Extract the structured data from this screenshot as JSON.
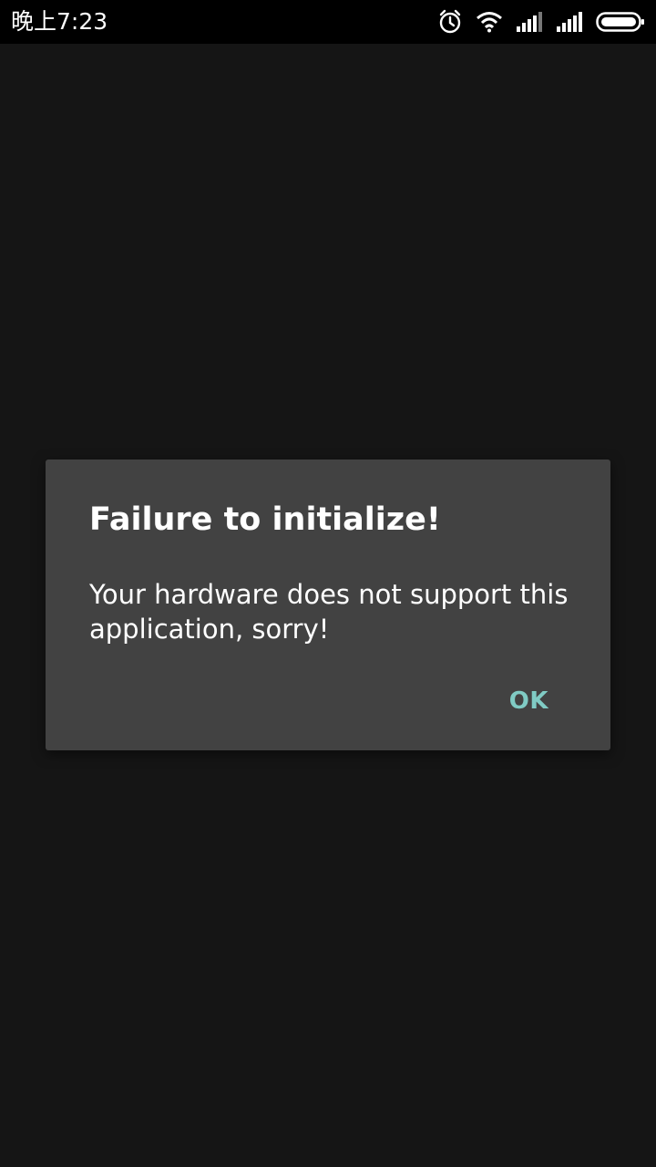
{
  "status_bar": {
    "time": "晚上7:23",
    "icons": [
      "alarm-icon",
      "wifi-icon",
      "signal-1-icon",
      "signal-2-icon",
      "battery-icon"
    ]
  },
  "dialog": {
    "title": "Failure to initialize!",
    "message": "Your hardware does not support this application, sorry!",
    "ok_label": "OK"
  },
  "colors": {
    "background": "#151515",
    "status_bar": "#000000",
    "dialog_bg": "#424242",
    "accent": "#80cbc4"
  }
}
